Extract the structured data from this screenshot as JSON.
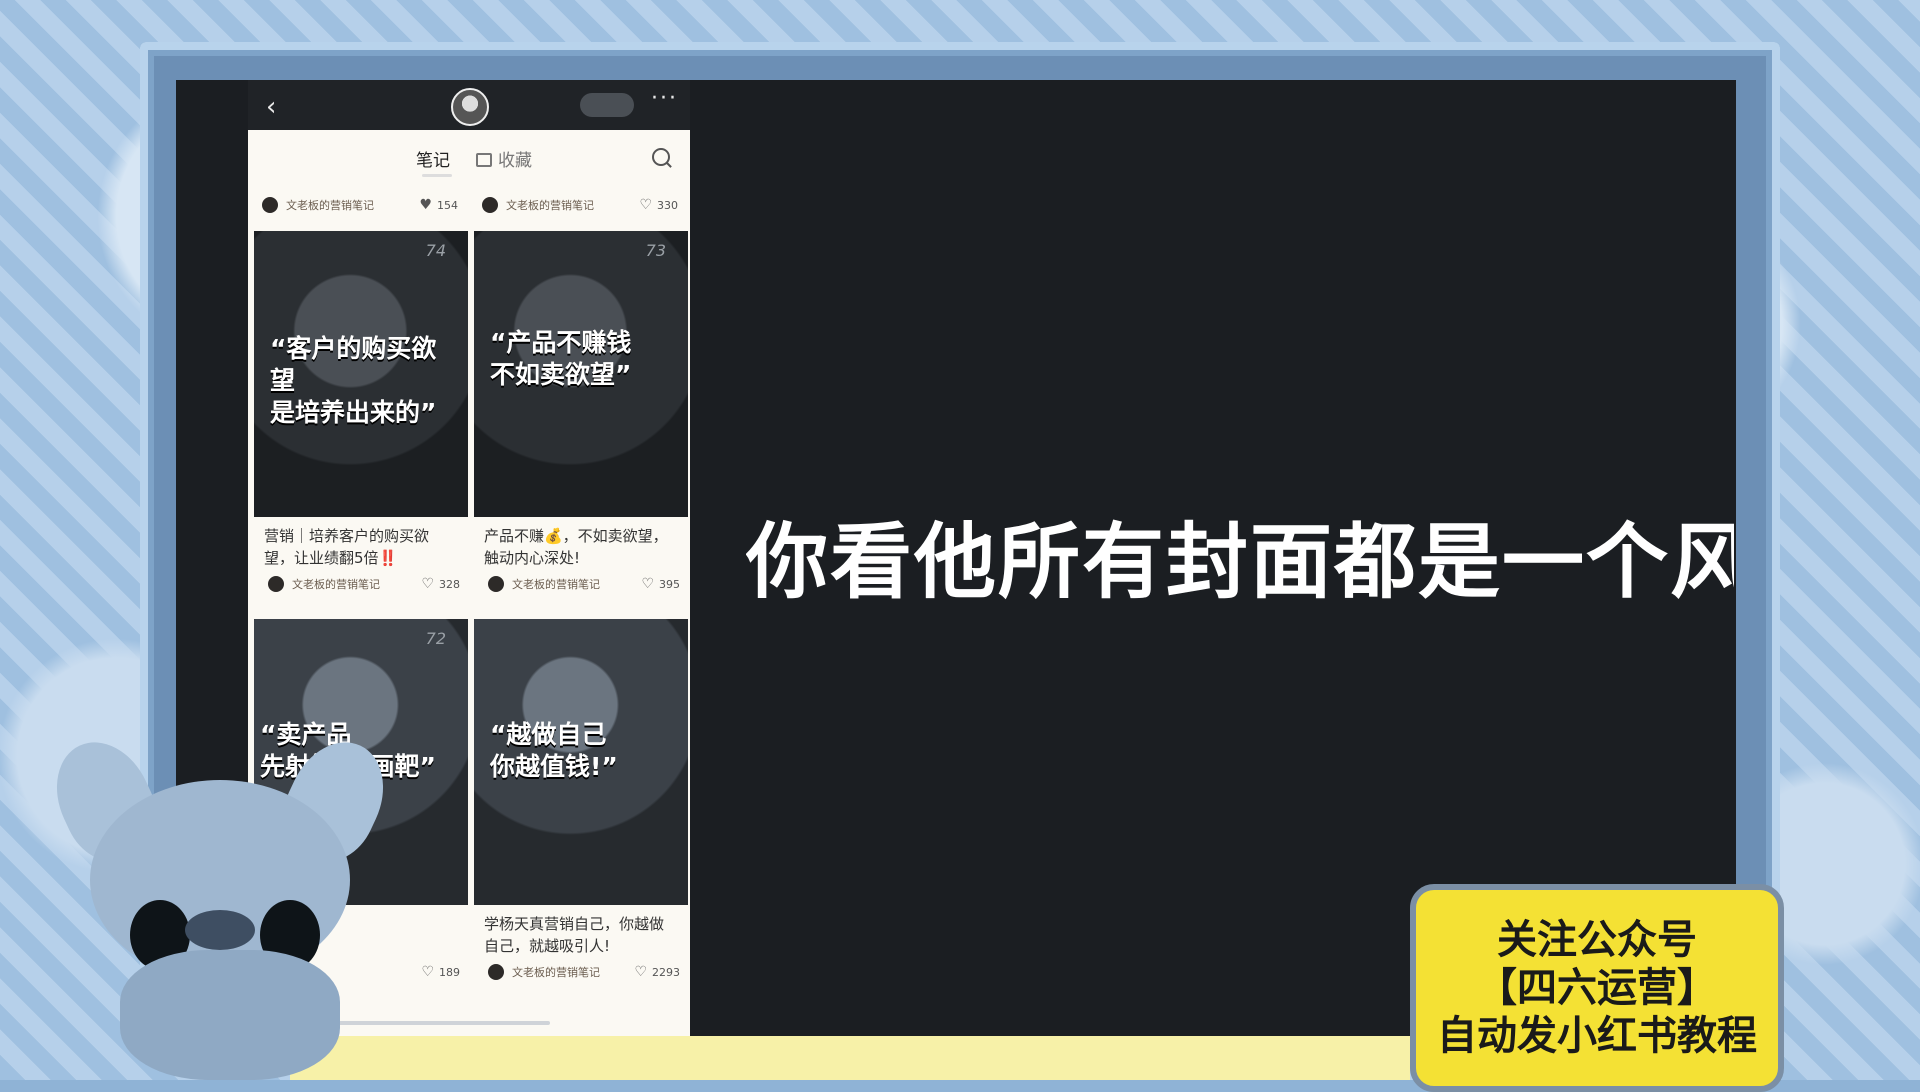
{
  "phone": {
    "header": {
      "back_icon": "chevron-left-icon",
      "more_label": "···",
      "follow_label": ""
    },
    "tabs": {
      "notes": "笔记",
      "favorites": "收藏"
    },
    "top_meta": [
      {
        "author": "文老板的营销笔记",
        "likes": "154"
      },
      {
        "author": "文老板的营销笔记",
        "likes": "330"
      }
    ],
    "cards": [
      {
        "cover_quote_1": "“客户的购买欲望",
        "cover_quote_2": "是培养出来的”",
        "title": "营销｜培养客户的购买欲望，让业绩翻5倍‼️",
        "author": "文老板的营销笔记",
        "likes": "328",
        "num": "74"
      },
      {
        "cover_quote_1": "“产品不赚钱",
        "cover_quote_2": "不如卖欲望”",
        "title": "产品不赚💰，不如卖欲望，触动内心深处!",
        "author": "文老板的营销笔记",
        "likes": "395",
        "num": "73"
      },
      {
        "cover_quote_1": "“卖产品",
        "cover_quote_2": "先射箭,再画靶”",
        "title": "",
        "author": "",
        "likes": "189",
        "num": "72"
      },
      {
        "cover_quote_1": "“越做自己",
        "cover_quote_2": "你越值钱!”",
        "title": "学杨天真营销自己，你越做自己，就越吸引人!",
        "author": "文老板的营销笔记",
        "likes": "2293",
        "num": ""
      }
    ]
  },
  "subtitle": "你看他所有封面都是一个风格",
  "promo": {
    "line1": "关注公众号",
    "line2": "【四六运营】",
    "line3": "自动发小红书教程"
  }
}
